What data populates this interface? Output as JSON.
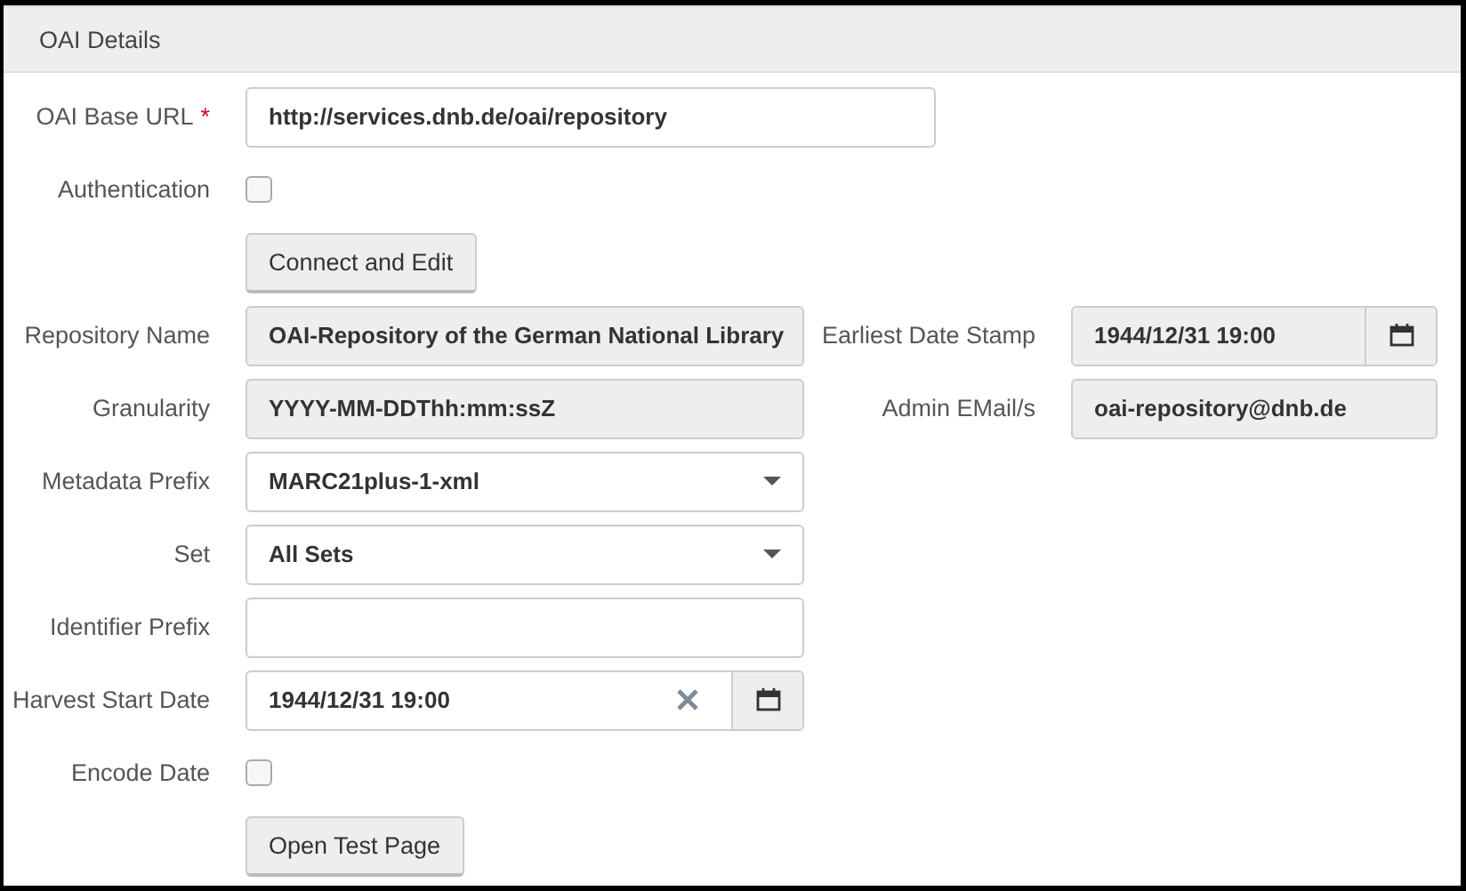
{
  "panel": {
    "title": "OAI Details"
  },
  "rows": [
    {
      "label": "OAI Base URL",
      "required_mark": "*",
      "field": {
        "kind": "text",
        "wide": true,
        "value": "http://services.dnb.de/oai/repository"
      }
    },
    {
      "label": "Authentication",
      "field": {
        "kind": "checkbox",
        "checked": false
      }
    },
    {
      "field": {
        "kind": "button",
        "text": "Connect and Edit"
      }
    },
    {
      "label": "Repository Name",
      "field": {
        "kind": "readonly",
        "value": "OAI-Repository of the German National Library"
      },
      "right": {
        "label": "Earliest Date Stamp",
        "field": {
          "kind": "readonly-date",
          "value": "1944/12/31 19:00"
        }
      }
    },
    {
      "label": "Granularity",
      "field": {
        "kind": "readonly",
        "value": "YYYY-MM-DDThh:mm:ssZ"
      },
      "right": {
        "label": "Admin EMail/s",
        "field": {
          "kind": "readonly",
          "value": "oai-repository@dnb.de"
        }
      }
    },
    {
      "label": "Metadata Prefix",
      "field": {
        "kind": "select",
        "value": "MARC21plus-1-xml"
      }
    },
    {
      "label": "Set",
      "field": {
        "kind": "select",
        "value": "All Sets"
      }
    },
    {
      "label": "Identifier Prefix",
      "field": {
        "kind": "text",
        "wide": false
      }
    },
    {
      "label": "Harvest Start Date",
      "field": {
        "kind": "date",
        "value": "1944/12/31 19:00"
      }
    },
    {
      "label": "Encode Date",
      "field": {
        "kind": "checkbox",
        "checked": false
      }
    },
    {
      "field": {
        "kind": "button",
        "text": "Open Test Page"
      }
    }
  ]
}
